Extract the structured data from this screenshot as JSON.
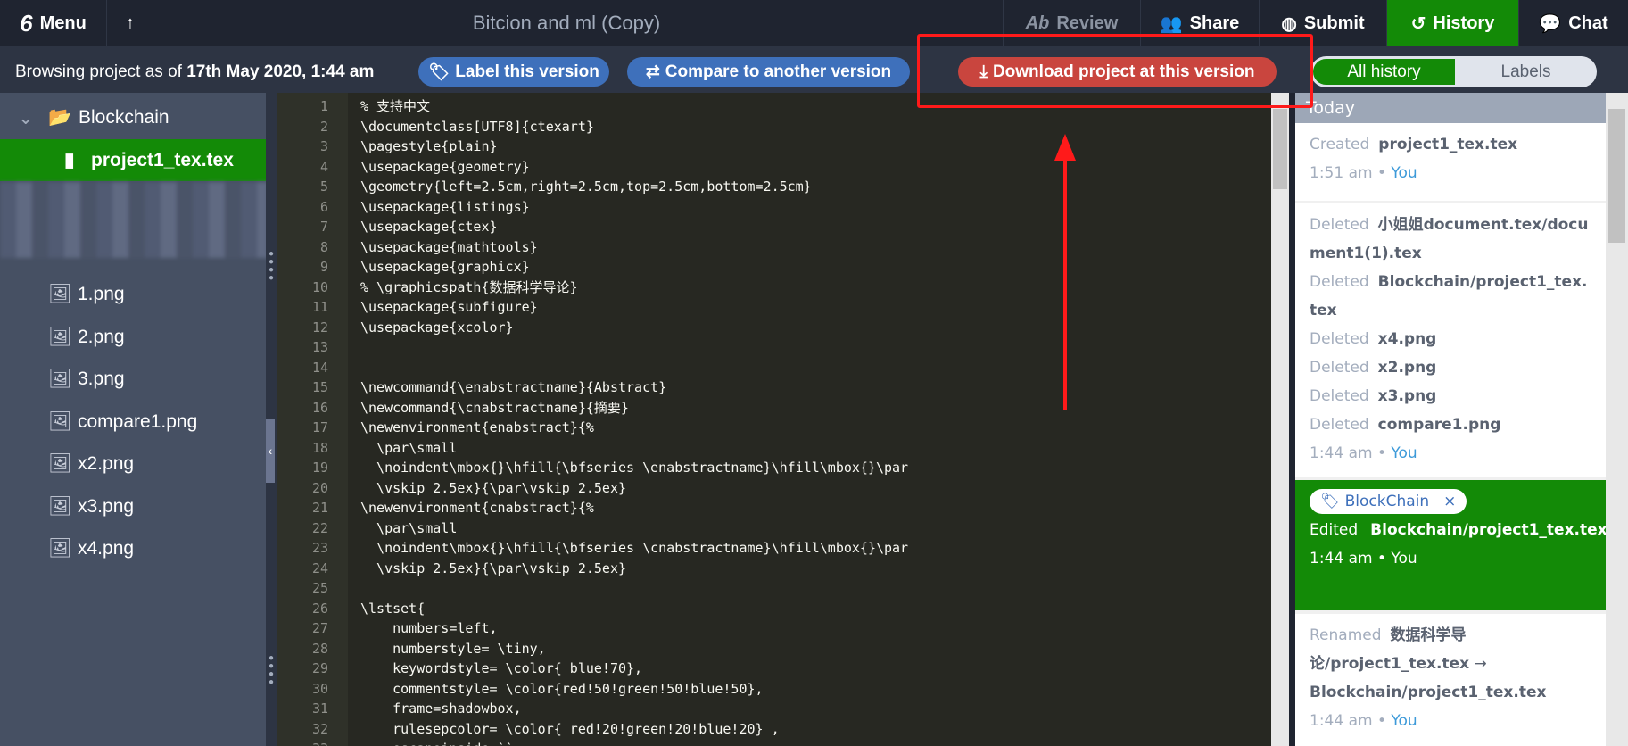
{
  "topbar": {
    "menu": "Menu",
    "title": "Bitcion and ml (Copy)",
    "review": "Review",
    "share": "Share",
    "submit": "Submit",
    "history": "History",
    "chat": "Chat"
  },
  "subbar": {
    "browsing_prefix": "Browsing project as of ",
    "browsing_date": "17th May 2020, 1:44 am",
    "label_btn": "Label this version",
    "compare_btn": "Compare to another version",
    "download_btn": "Download project at this version",
    "all_history": "All history",
    "labels": "Labels"
  },
  "sidebar": {
    "folder": "Blockchain",
    "active_file": "project1_tex.tex",
    "files": [
      "1.png",
      "2.png",
      "3.png",
      "compare1.png",
      "x2.png",
      "x3.png",
      "x4.png"
    ]
  },
  "editor": {
    "lines": [
      "% 支持中文",
      "\\documentclass[UTF8]{ctexart}",
      "\\pagestyle{plain}",
      "\\usepackage{geometry}",
      "\\geometry{left=2.5cm,right=2.5cm,top=2.5cm,bottom=2.5cm}",
      "\\usepackage{listings}",
      "\\usepackage{ctex}",
      "\\usepackage{mathtools}",
      "\\usepackage{graphicx}",
      "% \\graphicspath{数据科学导论}",
      "\\usepackage{subfigure}",
      "\\usepackage{xcolor}",
      "",
      "",
      "\\newcommand{\\enabstractname}{Abstract}",
      "\\newcommand{\\cnabstractname}{摘要}",
      "\\newenvironment{enabstract}{%",
      "  \\par\\small",
      "  \\noindent\\mbox{}\\hfill{\\bfseries \\enabstractname}\\hfill\\mbox{}\\par",
      "  \\vskip 2.5ex}{\\par\\vskip 2.5ex}",
      "\\newenvironment{cnabstract}{%",
      "  \\par\\small",
      "  \\noindent\\mbox{}\\hfill{\\bfseries \\cnabstractname}\\hfill\\mbox{}\\par",
      "  \\vskip 2.5ex}{\\par\\vskip 2.5ex}",
      "",
      "\\lstset{",
      "    numbers=left,",
      "    numberstyle= \\tiny,",
      "    keywordstyle= \\color{ blue!70},",
      "    commentstyle= \\color{red!50!green!50!blue!50},",
      "    frame=shadowbox,",
      "    rulesepcolor= \\color{ red!20!green!20!blue!20} ,",
      "    escapeinside=``"
    ]
  },
  "history": {
    "day": "Today",
    "e1": {
      "action": "Created",
      "file": "project1_tex.tex",
      "time": "1:51 am",
      "user": "You"
    },
    "e2": {
      "items": [
        {
          "action": "Deleted",
          "file": "小姐姐document.tex/document1(1).tex"
        },
        {
          "action": "Deleted",
          "file": "Blockchain/project1_tex.tex"
        },
        {
          "action": "Deleted",
          "file": "x4.png"
        },
        {
          "action": "Deleted",
          "file": "x2.png"
        },
        {
          "action": "Deleted",
          "file": "x3.png"
        },
        {
          "action": "Deleted",
          "file": "compare1.png"
        }
      ],
      "time": "1:44 am",
      "user": "You"
    },
    "e3": {
      "label": "BlockChain",
      "action": "Edited",
      "file": "Blockchain/project1_tex.tex",
      "time": "1:44 am",
      "user": "You"
    },
    "e4": {
      "action": "Renamed",
      "from": "数据科学导论/project1_tex.tex",
      "arrow": "→",
      "to": "Blockchain/project1_tex.tex",
      "time": "1:44 am",
      "user": "You"
    }
  },
  "colors": {
    "green": "#138a07",
    "blue": "#3e70bb",
    "red": "#c9453e",
    "annotation": "#ff1a1a"
  },
  "sep": " • "
}
